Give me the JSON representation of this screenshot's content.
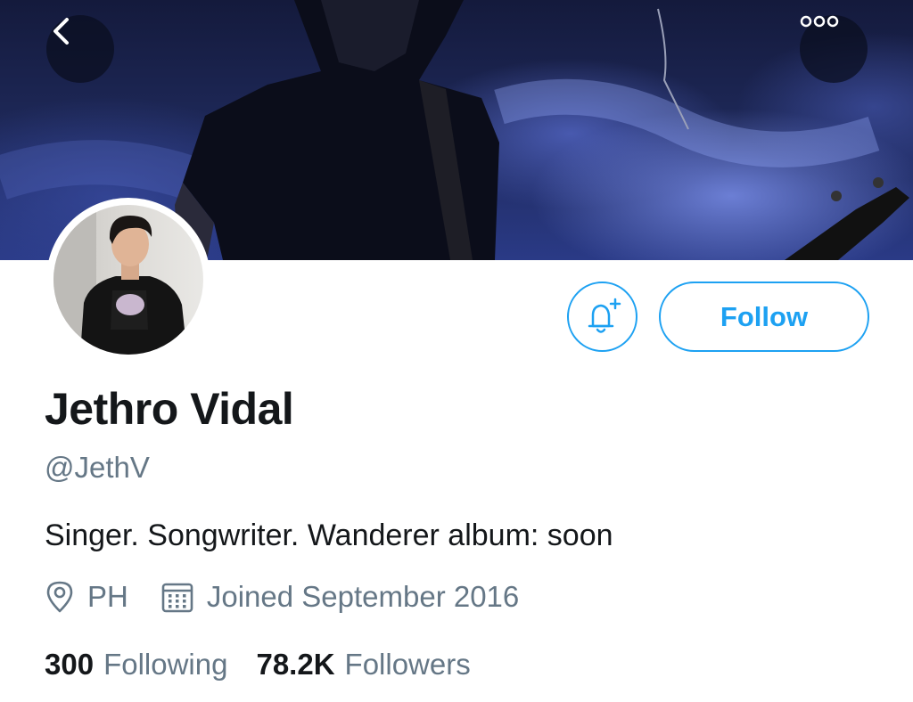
{
  "header": {
    "back_icon": "chevron-left-icon",
    "more_icon": "more-horizontal-icon"
  },
  "profile": {
    "display_name": "Jethro Vidal",
    "handle": "@JethV",
    "bio": "Singer. Songwriter. Wanderer album: soon",
    "location": "PH",
    "joined": "Joined September 2016"
  },
  "actions": {
    "notify_icon": "bell-plus-icon",
    "follow_label": "Follow"
  },
  "stats": {
    "following_count": "300",
    "following_label": "Following",
    "followers_count": "78.2K",
    "followers_label": "Followers"
  },
  "colors": {
    "accent": "#1da1f2",
    "primary_text": "#14171a",
    "secondary_text": "#657786"
  }
}
